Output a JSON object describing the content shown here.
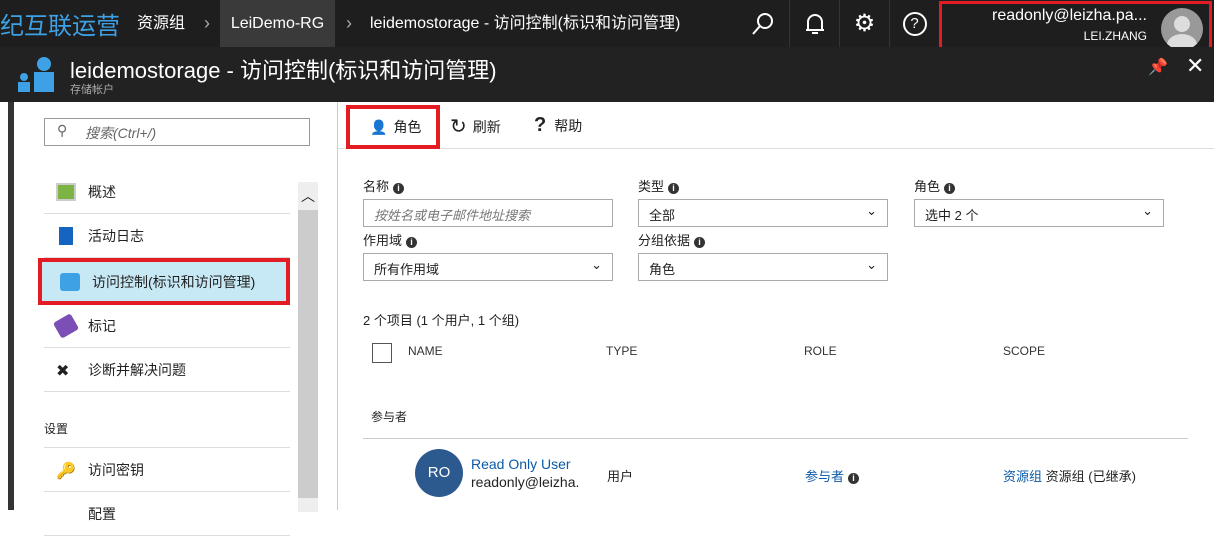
{
  "topbar": {
    "brand": "纪互联运营",
    "breadcrumbs": [
      "资源组",
      "LeiDemo-RG",
      "leidemostorage - 访问控制(标识和访问管理)"
    ],
    "user_email": "readonly@leizha.pa...",
    "user_name": "LEI.ZHANG"
  },
  "blade": {
    "title": "leidemostorage - 访问控制(标识和访问管理)",
    "subtitle": "存储帐户"
  },
  "sidebar": {
    "search_placeholder": "搜索(Ctrl+/)",
    "items": [
      {
        "label": "概述"
      },
      {
        "label": "活动日志"
      },
      {
        "label": "访问控制(标识和访问管理)"
      },
      {
        "label": "标记"
      },
      {
        "label": "诊断并解决问题"
      }
    ],
    "section": "设置",
    "settings_items": [
      {
        "label": "访问密钥"
      },
      {
        "label": "配置"
      }
    ]
  },
  "toolbar": {
    "roles": "角色",
    "refresh": "刷新",
    "help": "帮助"
  },
  "filters": {
    "name_label": "名称",
    "name_placeholder": "按姓名或电子邮件地址搜索",
    "type_label": "类型",
    "type_value": "全部",
    "role_label": "角色",
    "role_value": "选中 2 个",
    "scope_label": "作用域",
    "scope_value": "所有作用域",
    "group_label": "分组依据",
    "group_value": "角色"
  },
  "summary": "2 个项目 (1 个用户, 1 个组)",
  "table": {
    "headers": [
      "NAME",
      "TYPE",
      "ROLE",
      "SCOPE"
    ],
    "group": "参与者",
    "rows": [
      {
        "initials": "RO",
        "name": "Read Only User",
        "email": "readonly@leizha.",
        "type": "用户",
        "role": "参与者",
        "scope_link": "资源组",
        "scope_text": "资源组 (已继承)"
      }
    ]
  },
  "colors": {
    "accent": "#3ea1e6",
    "highlight": "#e31c23",
    "selected": "#c7e8f5",
    "avatar": "#2d5a8e",
    "link": "#0b5aa8"
  }
}
